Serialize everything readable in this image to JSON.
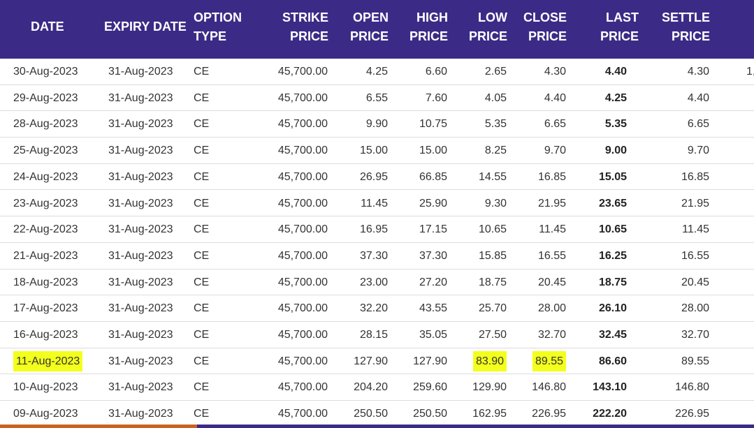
{
  "columns": [
    {
      "key": "date",
      "label": "DATE"
    },
    {
      "key": "expiry",
      "label": "EXPIRY DATE"
    },
    {
      "key": "type",
      "label": "OPTION\nTYPE"
    },
    {
      "key": "strike",
      "label": "STRIKE\nPRICE"
    },
    {
      "key": "open",
      "label": "OPEN\nPRICE"
    },
    {
      "key": "high",
      "label": "HIGH\nPRICE"
    },
    {
      "key": "low",
      "label": "LOW\nPRICE"
    },
    {
      "key": "close",
      "label": "CLOSE\nPRICE"
    },
    {
      "key": "last",
      "label": "LAST\nPRICE"
    },
    {
      "key": "settle",
      "label": "SETTLE\nPRICE"
    }
  ],
  "rows": [
    {
      "date": "30-Aug-2023",
      "expiry": "31-Aug-2023",
      "type": "CE",
      "strike": "45,700.00",
      "open": "4.25",
      "high": "6.60",
      "low": "2.65",
      "close": "4.30",
      "last": "4.40",
      "settle": "4.30"
    },
    {
      "date": "29-Aug-2023",
      "expiry": "31-Aug-2023",
      "type": "CE",
      "strike": "45,700.00",
      "open": "6.55",
      "high": "7.60",
      "low": "4.05",
      "close": "4.40",
      "last": "4.25",
      "settle": "4.40"
    },
    {
      "date": "28-Aug-2023",
      "expiry": "31-Aug-2023",
      "type": "CE",
      "strike": "45,700.00",
      "open": "9.90",
      "high": "10.75",
      "low": "5.35",
      "close": "6.65",
      "last": "5.35",
      "settle": "6.65"
    },
    {
      "date": "25-Aug-2023",
      "expiry": "31-Aug-2023",
      "type": "CE",
      "strike": "45,700.00",
      "open": "15.00",
      "high": "15.00",
      "low": "8.25",
      "close": "9.70",
      "last": "9.00",
      "settle": "9.70"
    },
    {
      "date": "24-Aug-2023",
      "expiry": "31-Aug-2023",
      "type": "CE",
      "strike": "45,700.00",
      "open": "26.95",
      "high": "66.85",
      "low": "14.55",
      "close": "16.85",
      "last": "15.05",
      "settle": "16.85"
    },
    {
      "date": "23-Aug-2023",
      "expiry": "31-Aug-2023",
      "type": "CE",
      "strike": "45,700.00",
      "open": "11.45",
      "high": "25.90",
      "low": "9.30",
      "close": "21.95",
      "last": "23.65",
      "settle": "21.95"
    },
    {
      "date": "22-Aug-2023",
      "expiry": "31-Aug-2023",
      "type": "CE",
      "strike": "45,700.00",
      "open": "16.95",
      "high": "17.15",
      "low": "10.65",
      "close": "11.45",
      "last": "10.65",
      "settle": "11.45"
    },
    {
      "date": "21-Aug-2023",
      "expiry": "31-Aug-2023",
      "type": "CE",
      "strike": "45,700.00",
      "open": "37.30",
      "high": "37.30",
      "low": "15.85",
      "close": "16.55",
      "last": "16.25",
      "settle": "16.55"
    },
    {
      "date": "18-Aug-2023",
      "expiry": "31-Aug-2023",
      "type": "CE",
      "strike": "45,700.00",
      "open": "23.00",
      "high": "27.20",
      "low": "18.75",
      "close": "20.45",
      "last": "18.75",
      "settle": "20.45"
    },
    {
      "date": "17-Aug-2023",
      "expiry": "31-Aug-2023",
      "type": "CE",
      "strike": "45,700.00",
      "open": "32.20",
      "high": "43.55",
      "low": "25.70",
      "close": "28.00",
      "last": "26.10",
      "settle": "28.00"
    },
    {
      "date": "16-Aug-2023",
      "expiry": "31-Aug-2023",
      "type": "CE",
      "strike": "45,700.00",
      "open": "28.15",
      "high": "35.05",
      "low": "27.50",
      "close": "32.70",
      "last": "32.45",
      "settle": "32.70"
    },
    {
      "date": "11-Aug-2023",
      "expiry": "31-Aug-2023",
      "type": "CE",
      "strike": "45,700.00",
      "open": "127.90",
      "high": "127.90",
      "low": "83.90",
      "close": "89.55",
      "last": "86.60",
      "settle": "89.55",
      "highlight": [
        "date",
        "low",
        "close"
      ]
    },
    {
      "date": "10-Aug-2023",
      "expiry": "31-Aug-2023",
      "type": "CE",
      "strike": "45,700.00",
      "open": "204.20",
      "high": "259.60",
      "low": "129.90",
      "close": "146.80",
      "last": "143.10",
      "settle": "146.80"
    },
    {
      "date": "09-Aug-2023",
      "expiry": "31-Aug-2023",
      "type": "CE",
      "strike": "45,700.00",
      "open": "250.50",
      "high": "250.50",
      "low": "162.95",
      "close": "226.95",
      "last": "222.20",
      "settle": "226.95"
    }
  ],
  "edge_fragment": "1,",
  "colors": {
    "header_bg": "#3b2b86",
    "highlight": "#f3ff1c",
    "accent": "#c7641f"
  }
}
